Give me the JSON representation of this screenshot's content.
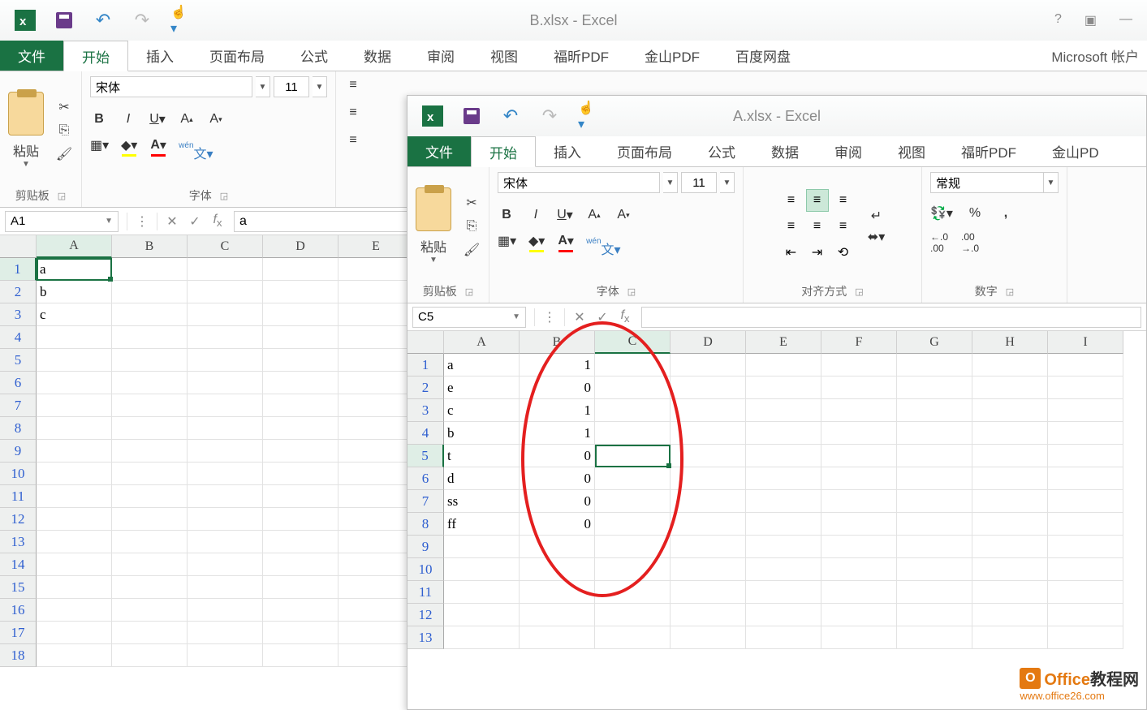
{
  "back": {
    "title": "B.xlsx - Excel",
    "qat_touch": "",
    "tabs": {
      "file": "文件",
      "home": "开始",
      "insert": "插入",
      "layout": "页面布局",
      "formula": "公式",
      "data": "数据",
      "review": "审阅",
      "view": "视图",
      "foxit": "福昕PDF",
      "wps": "金山PDF",
      "baidu": "百度网盘"
    },
    "account": "Microsoft 帐户",
    "paste_label": "粘贴",
    "group_clip": "剪贴板",
    "group_font": "字体",
    "font_name": "宋体",
    "font_size": "11",
    "namebox": "A1",
    "fx_value": "a",
    "cols": [
      "A",
      "B",
      "C",
      "D",
      "E"
    ],
    "rows": [
      {
        "n": "1",
        "A": "a"
      },
      {
        "n": "2",
        "A": "b"
      },
      {
        "n": "3",
        "A": "c"
      },
      {
        "n": "4"
      },
      {
        "n": "5"
      },
      {
        "n": "6"
      },
      {
        "n": "7"
      },
      {
        "n": "8"
      },
      {
        "n": "9"
      },
      {
        "n": "10"
      },
      {
        "n": "11"
      },
      {
        "n": "12"
      },
      {
        "n": "13"
      },
      {
        "n": "14"
      },
      {
        "n": "15"
      },
      {
        "n": "16"
      },
      {
        "n": "17"
      },
      {
        "n": "18"
      }
    ]
  },
  "front": {
    "title": "A.xlsx - Excel",
    "tabs": {
      "file": "文件",
      "home": "开始",
      "insert": "插入",
      "layout": "页面布局",
      "formula": "公式",
      "data": "数据",
      "review": "审阅",
      "view": "视图",
      "foxit": "福昕PDF",
      "wps": "金山PD"
    },
    "paste_label": "粘贴",
    "group_clip": "剪贴板",
    "group_font": "字体",
    "group_align": "对齐方式",
    "group_num": "数字",
    "font_name": "宋体",
    "font_size": "11",
    "num_format": "常规",
    "namebox": "C5",
    "fx_value": "",
    "cols": [
      "A",
      "B",
      "C",
      "D",
      "E",
      "F",
      "G",
      "H",
      "I"
    ],
    "rows": [
      {
        "n": "1",
        "A": "a",
        "B": "1"
      },
      {
        "n": "2",
        "A": "e",
        "B": "0"
      },
      {
        "n": "3",
        "A": "c",
        "B": "1"
      },
      {
        "n": "4",
        "A": "b",
        "B": "1"
      },
      {
        "n": "5",
        "A": "t",
        "B": "0"
      },
      {
        "n": "6",
        "A": "d",
        "B": "0"
      },
      {
        "n": "7",
        "A": "ss",
        "B": "0"
      },
      {
        "n": "8",
        "A": "ff",
        "B": "0"
      },
      {
        "n": "9"
      },
      {
        "n": "10"
      },
      {
        "n": "11"
      },
      {
        "n": "12"
      },
      {
        "n": "13"
      }
    ],
    "selected_cell": "C5"
  },
  "watermark": {
    "brand": "Office教程网",
    "url": "www.office26.com"
  }
}
